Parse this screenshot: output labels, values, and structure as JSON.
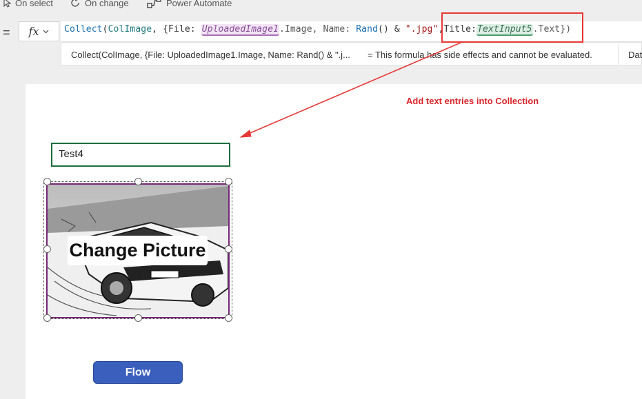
{
  "toolbar": {
    "on_select": "On select",
    "on_change": "On change",
    "power_automate": "Power Automate"
  },
  "formula": {
    "equals": "=",
    "fx": "fx",
    "tokens": {
      "collect": "Collect",
      "open_paren": "(",
      "collection": "ColImage",
      "t1": ", {File: ",
      "uploaded": "UploadedImage1",
      "t2": ".Image, Name: ",
      "rand": "Rand",
      "t3": "() & ",
      "jpg": "\".jpg\"",
      "t4": ",Title:",
      "textinput": "TextInput5",
      "t5": ".Text})"
    }
  },
  "hint": {
    "preview": "Collect(ColImage, {File: UploadedImage1.Image, Name: Rand() & \".j...",
    "message": "=  This formula has side effects and cannot be evaluated.",
    "data_tab": "Dat"
  },
  "annotation": {
    "text": "Add text entries into Collection",
    "color": "#d9252a"
  },
  "canvas": {
    "text_input_value": "Test4",
    "picture_label": "Change Picture",
    "flow_button": "Flow"
  },
  "colors": {
    "accent": "#742774",
    "button": "#3b5fbd",
    "input_border": "#1e6e3c"
  }
}
